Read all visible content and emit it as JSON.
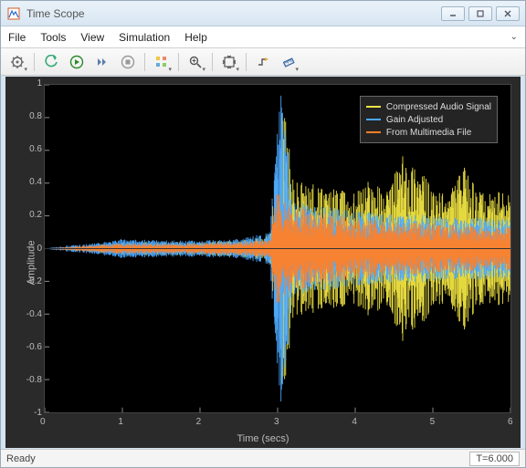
{
  "window": {
    "title": "Time Scope"
  },
  "menu": {
    "file": "File",
    "tools": "Tools",
    "view": "View",
    "simulation": "Simulation",
    "help": "Help"
  },
  "chart_data": {
    "type": "line",
    "title": "",
    "xlabel": "Time (secs)",
    "ylabel": "Amplitude",
    "xlim": [
      0,
      6
    ],
    "ylim": [
      -1,
      1
    ],
    "xticks": [
      0,
      1,
      2,
      3,
      4,
      5,
      6
    ],
    "yticks": [
      -1,
      -0.8,
      -0.6,
      -0.4,
      -0.2,
      0,
      0.2,
      0.4,
      0.6,
      0.8,
      1
    ],
    "legend_position": "upper right",
    "series": [
      {
        "name": "Compressed Audio Signal",
        "color": "#f0e442",
        "envelope_x": [
          0.0,
          0.3,
          0.6,
          1.0,
          1.5,
          2.0,
          2.5,
          2.9,
          3.0,
          3.05,
          3.2,
          3.4,
          3.6,
          3.8,
          4.0,
          4.2,
          4.4,
          4.6,
          4.8,
          5.0,
          5.2,
          5.4,
          5.6,
          5.8,
          6.0
        ],
        "envelope_abs": [
          0.0,
          0.01,
          0.02,
          0.04,
          0.04,
          0.04,
          0.05,
          0.08,
          0.6,
          1.0,
          0.42,
          0.4,
          0.38,
          0.36,
          0.35,
          0.45,
          0.34,
          0.58,
          0.55,
          0.34,
          0.35,
          0.5,
          0.35,
          0.35,
          0.34
        ]
      },
      {
        "name": "Gain Adjusted",
        "color": "#4aa8ff",
        "envelope_x": [
          0.0,
          0.3,
          0.6,
          1.0,
          1.5,
          2.0,
          2.5,
          2.9,
          3.0,
          3.05,
          3.2,
          3.4,
          3.6,
          3.8,
          4.0,
          4.2,
          4.4,
          4.6,
          4.8,
          5.0,
          5.2,
          5.4,
          5.6,
          5.8,
          6.0
        ],
        "envelope_abs": [
          0.0,
          0.02,
          0.03,
          0.06,
          0.05,
          0.05,
          0.06,
          0.1,
          0.8,
          1.0,
          0.3,
          0.28,
          0.26,
          0.24,
          0.23,
          0.22,
          0.21,
          0.21,
          0.21,
          0.2,
          0.2,
          0.19,
          0.19,
          0.19,
          0.18
        ]
      },
      {
        "name": "From Multimedia File",
        "color": "#ff7f27",
        "envelope_x": [
          0.0,
          0.3,
          0.6,
          1.0,
          1.5,
          2.0,
          2.5,
          2.9,
          3.0,
          3.05,
          3.2,
          3.4,
          3.6,
          3.8,
          4.0,
          4.2,
          4.4,
          4.6,
          4.8,
          5.0,
          5.2,
          5.4,
          5.6,
          5.8,
          6.0
        ],
        "envelope_abs": [
          0.0,
          0.01,
          0.02,
          0.03,
          0.03,
          0.03,
          0.04,
          0.06,
          0.4,
          0.3,
          0.26,
          0.24,
          0.22,
          0.2,
          0.19,
          0.18,
          0.17,
          0.16,
          0.16,
          0.15,
          0.15,
          0.14,
          0.14,
          0.13,
          0.13
        ]
      }
    ]
  },
  "legend": {
    "items": [
      {
        "label": "Compressed Audio Signal",
        "color": "#f0e442"
      },
      {
        "label": "Gain Adjusted",
        "color": "#4aa8ff"
      },
      {
        "label": "From Multimedia File",
        "color": "#ff7f27"
      }
    ]
  },
  "status": {
    "ready": "Ready",
    "time": "T=6.000"
  },
  "yticklabels": [
    "-1",
    "-0.8",
    "-0.6",
    "-0.4",
    "-0.2",
    "0",
    "0.2",
    "0.4",
    "0.6",
    "0.8",
    "1"
  ],
  "xticklabels": [
    "0",
    "1",
    "2",
    "3",
    "4",
    "5",
    "6"
  ]
}
